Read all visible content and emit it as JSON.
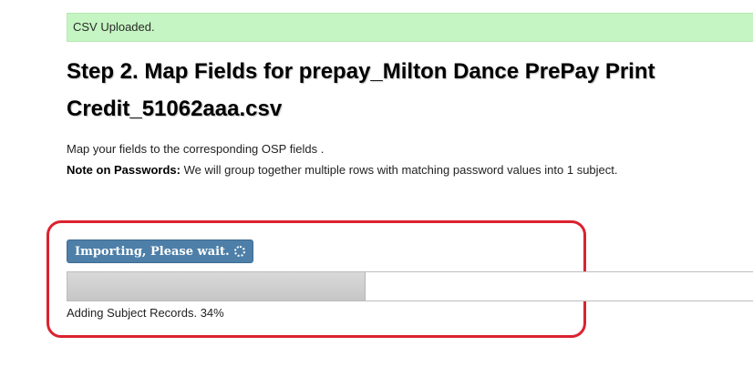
{
  "alert": {
    "text": "CSV Uploaded."
  },
  "heading": {
    "title": "Step 2. Map Fields for prepay_Milton Dance PrePay Print Credit_51062aaa.csv"
  },
  "description": {
    "line1": "Map your fields to the corresponding OSP fields .",
    "note_label": "Note on Passwords:",
    "note_text": " We will group together multiple rows with matching password values into 1 subject."
  },
  "import": {
    "button_label": "Importing, Please wait.",
    "progress_fraction": 0.435,
    "status_text": "Adding Subject Records. 34%"
  },
  "colors": {
    "alert_bg": "#c5f5c2",
    "button_bg": "#4d7fa8",
    "highlight_border": "#dc2230"
  }
}
